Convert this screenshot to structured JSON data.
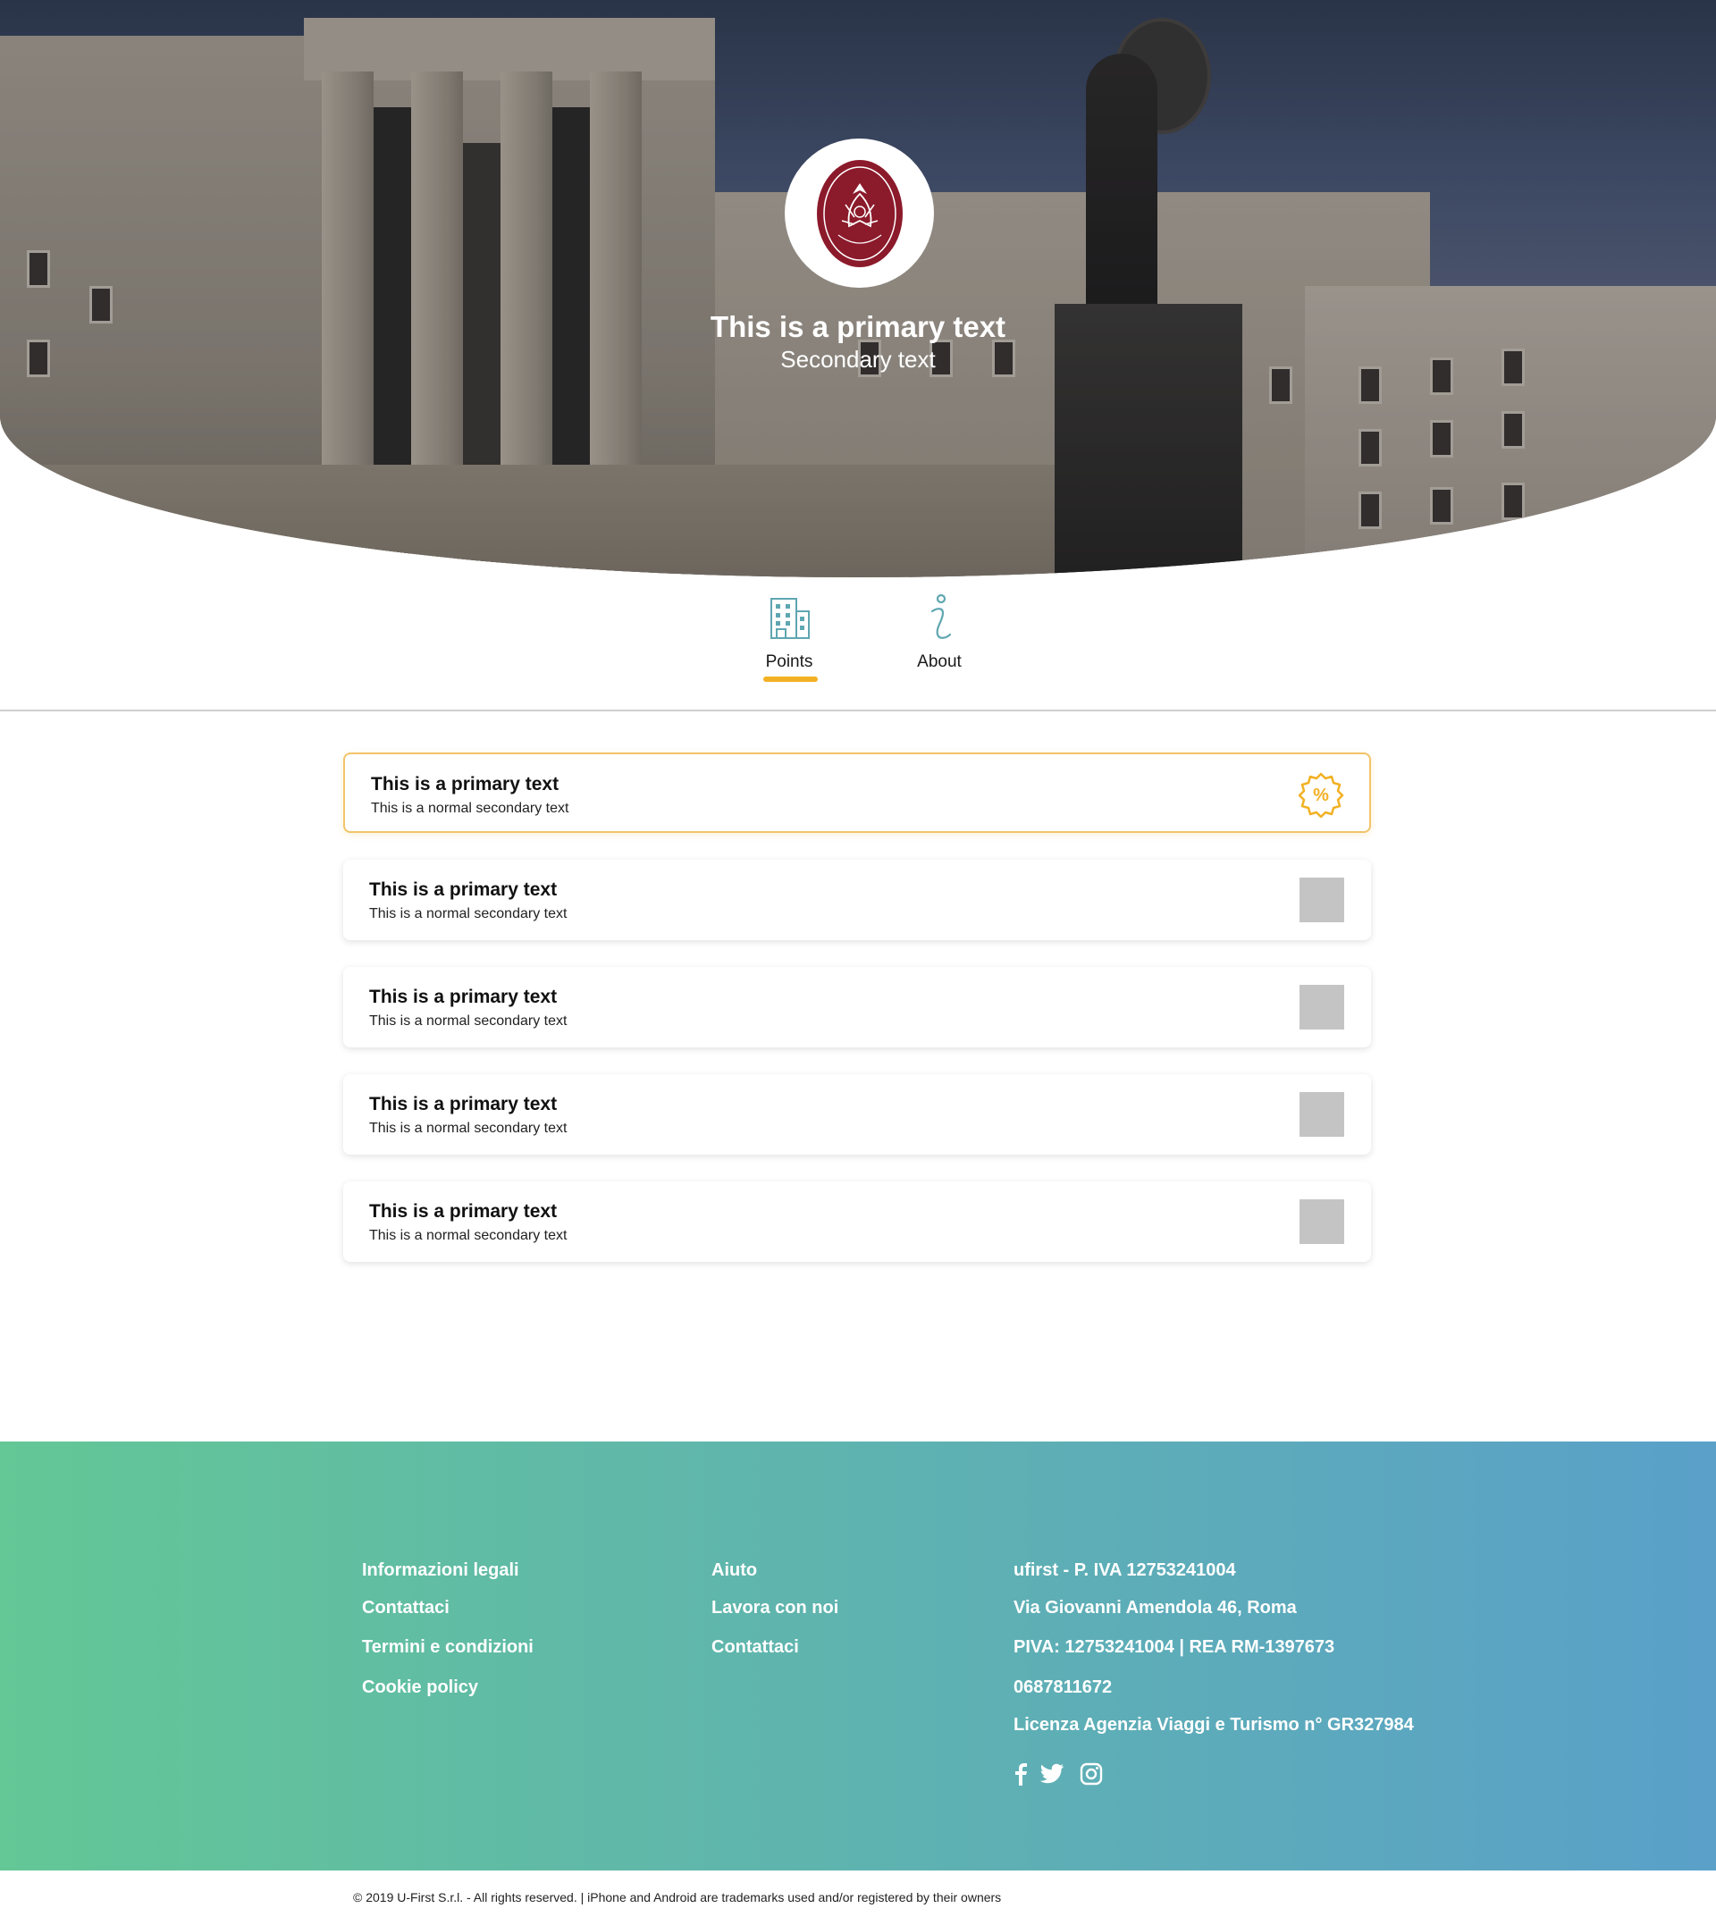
{
  "hero": {
    "title": "This is a primary text",
    "subtitle": "Secondary text",
    "logo_icon": "university-seal-icon",
    "logo_color": "#8b1a2b"
  },
  "tabs": [
    {
      "label": "Points",
      "icon": "building-icon",
      "active": true
    },
    {
      "label": "About",
      "icon": "info-icon",
      "active": false
    }
  ],
  "accent_color": "#f2b124",
  "cards": [
    {
      "primary": "This is a primary text",
      "secondary": "This is a normal secondary text",
      "icon": "discount-badge-icon",
      "highlighted": true
    },
    {
      "primary": "This is a primary text",
      "secondary": "This is a normal secondary text",
      "icon": "placeholder-thumbnail"
    },
    {
      "primary": "This is a primary text",
      "secondary": "This is a normal secondary text",
      "icon": "placeholder-thumbnail"
    },
    {
      "primary": "This is a primary text",
      "secondary": "This is a normal secondary text",
      "icon": "placeholder-thumbnail"
    },
    {
      "primary": "This is a primary text",
      "secondary": "This is a normal secondary text",
      "icon": "placeholder-thumbnail"
    }
  ],
  "footer": {
    "col1": [
      "Informazioni legali",
      "Contattaci",
      "Termini e condizioni",
      "Cookie policy"
    ],
    "col2": [
      "Aiuto",
      "Lavora con noi",
      "Contattaci"
    ],
    "company": [
      "ufirst - P. IVA 12753241004",
      "Via Giovanni Amendola 46, Roma",
      "PIVA: 12753241004 | REA RM-1397673",
      "0687811672",
      "Licenza Agenzia Viaggi e Turismo n° GR327984"
    ],
    "social_icons": [
      "facebook-icon",
      "twitter-icon",
      "instagram-icon"
    ],
    "gradient_start": "#63c796",
    "gradient_end": "#5aa0c9"
  },
  "copyright": "© 2019 U-First S.r.l. - All rights reserved. | iPhone and Android are trademarks used and/or registered by their owners"
}
